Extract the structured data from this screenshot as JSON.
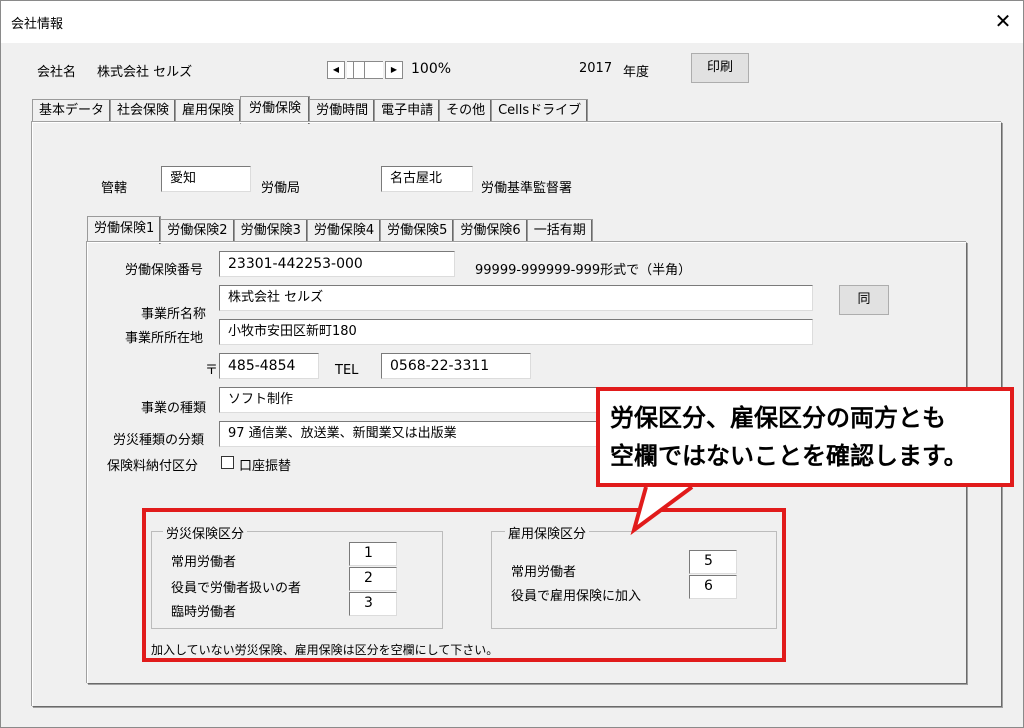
{
  "window": {
    "title": "会社情報",
    "close": "✕"
  },
  "header": {
    "company_label": "会社名",
    "company_name": "株式会社 セルズ",
    "zoom": "100%",
    "year": "2017",
    "year_label": "年度",
    "print_label": "印刷"
  },
  "main_tabs": [
    "基本データ",
    "社会保険",
    "雇用保険",
    "労働保険",
    "労働時間",
    "電子申請",
    "その他",
    "Cellsドライブ"
  ],
  "jurisdiction": {
    "label": "管轄",
    "prefecture": "愛知",
    "bureau_label": "労働局",
    "office": "名古屋北",
    "office_label": "労働基準監督署"
  },
  "sub_tabs": [
    "労働保険1",
    "労働保険2",
    "労働保険3",
    "労働保険4",
    "労働保険5",
    "労働保険6",
    "一括有期"
  ],
  "form": {
    "insurance_no_label": "労働保険番号",
    "insurance_no": "23301-442253-000",
    "insurance_no_hint": "99999-999999-999形式で（半角）",
    "office_name_label": "事業所名称",
    "office_name": "株式会社 セルズ",
    "same_label": "同",
    "office_address_label": "事業所所在地",
    "office_address": "小牧市安田区新町180",
    "postal_mark": "〒",
    "postal": "485-4854",
    "tel_label": "TEL",
    "tel": "0568-22-3311",
    "business_type_label": "事業の種類",
    "business_type": "ソフト制作",
    "accident_class_label": "労災種類の分類",
    "accident_class": "97 通信業、放送業、新聞業又は出版業",
    "payment_label": "保険料納付区分",
    "payment_option": "口座振替"
  },
  "rousai_group": {
    "title": "労災保険区分",
    "rows": [
      {
        "label": "常用労働者",
        "value": "1"
      },
      {
        "label": "役員で労働者扱いの者",
        "value": "2"
      },
      {
        "label": "臨時労働者",
        "value": "3"
      }
    ]
  },
  "koyou_group": {
    "title": "雇用保険区分",
    "rows": [
      {
        "label": "常用労働者",
        "value": "5"
      },
      {
        "label": "役員で雇用保険に加入",
        "value": "6"
      }
    ]
  },
  "note": "加入していない労災保険、雇用保険は区分を空欄にして下さい。",
  "callout": {
    "line1": "労保区分、雇保区分の両方とも",
    "line2": "空欄ではないことを確認します。"
  },
  "colors": {
    "highlight": "#e11b1b",
    "window_bg": "#f0f0f0"
  }
}
